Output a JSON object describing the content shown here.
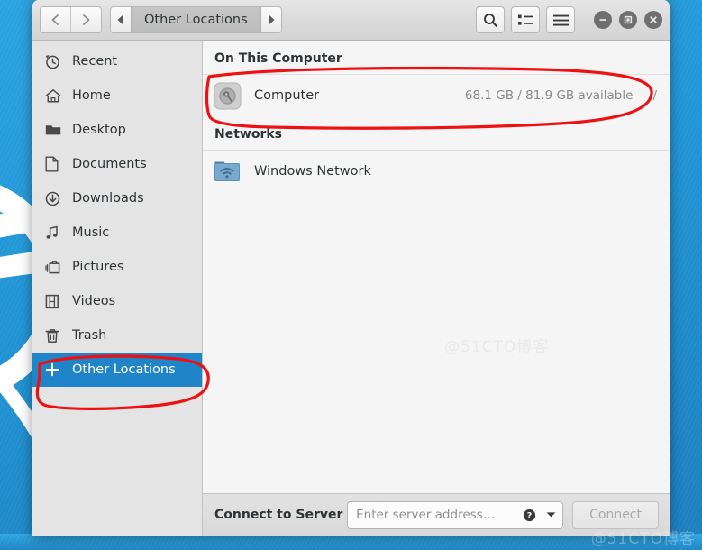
{
  "window": {
    "title": "Other Locations"
  },
  "headerbar": {
    "back_icon": "chevron-left-icon",
    "forward_icon": "chevron-right-icon",
    "path_prev_icon": "triangle-left-icon",
    "path_next_icon": "triangle-right-icon",
    "breadcrumb": "Other Locations",
    "search_icon": "search-icon",
    "view_toggle_icon": "list-view-icon",
    "menu_icon": "hamburger-menu-icon",
    "minimize_icon": "minimize-icon",
    "maximize_icon": "maximize-icon",
    "close_icon": "close-icon"
  },
  "sidebar": {
    "items": [
      {
        "label": "Recent",
        "icon": "clock-icon",
        "selected": false
      },
      {
        "label": "Home",
        "icon": "home-icon",
        "selected": false
      },
      {
        "label": "Desktop",
        "icon": "folder-icon",
        "selected": false
      },
      {
        "label": "Documents",
        "icon": "document-icon",
        "selected": false
      },
      {
        "label": "Downloads",
        "icon": "download-icon",
        "selected": false
      },
      {
        "label": "Music",
        "icon": "music-note-icon",
        "selected": false
      },
      {
        "label": "Pictures",
        "icon": "pictures-icon",
        "selected": false
      },
      {
        "label": "Videos",
        "icon": "film-icon",
        "selected": false
      },
      {
        "label": "Trash",
        "icon": "trash-icon",
        "selected": false
      },
      {
        "label": "Other Locations",
        "icon": "plus-icon",
        "selected": true
      }
    ]
  },
  "content": {
    "sections": [
      {
        "header": "On This Computer",
        "rows": [
          {
            "name": "Computer",
            "icon": "hard-drive-icon",
            "size": "68.1 GB / 81.9 GB available",
            "mount": "/"
          }
        ]
      },
      {
        "header": "Networks",
        "rows": [
          {
            "name": "Windows Network",
            "icon": "network-folder-icon",
            "size": "",
            "mount": ""
          }
        ]
      }
    ],
    "watermark": "@51CTO博客"
  },
  "actionbar": {
    "label": "Connect to Server",
    "input_value": "",
    "input_placeholder": "Enter server address…",
    "help_icon": "help-circle-icon",
    "dropdown_icon": "chevron-down-icon",
    "connect_label": "Connect"
  },
  "colors": {
    "selection_blue": "#2084c8",
    "desktop_blue": "#2094d4",
    "annotation_red": "#ee1111",
    "sidebar_bg": "#e4e4e4",
    "content_bg": "#f5f5f5",
    "headerbar_bg": "#dadada"
  },
  "annotations": {
    "computer_row_circle": "hand-drawn red ellipse around the Computer row",
    "other_locations_circle": "hand-drawn red ellipse around the Other Locations sidebar item"
  }
}
